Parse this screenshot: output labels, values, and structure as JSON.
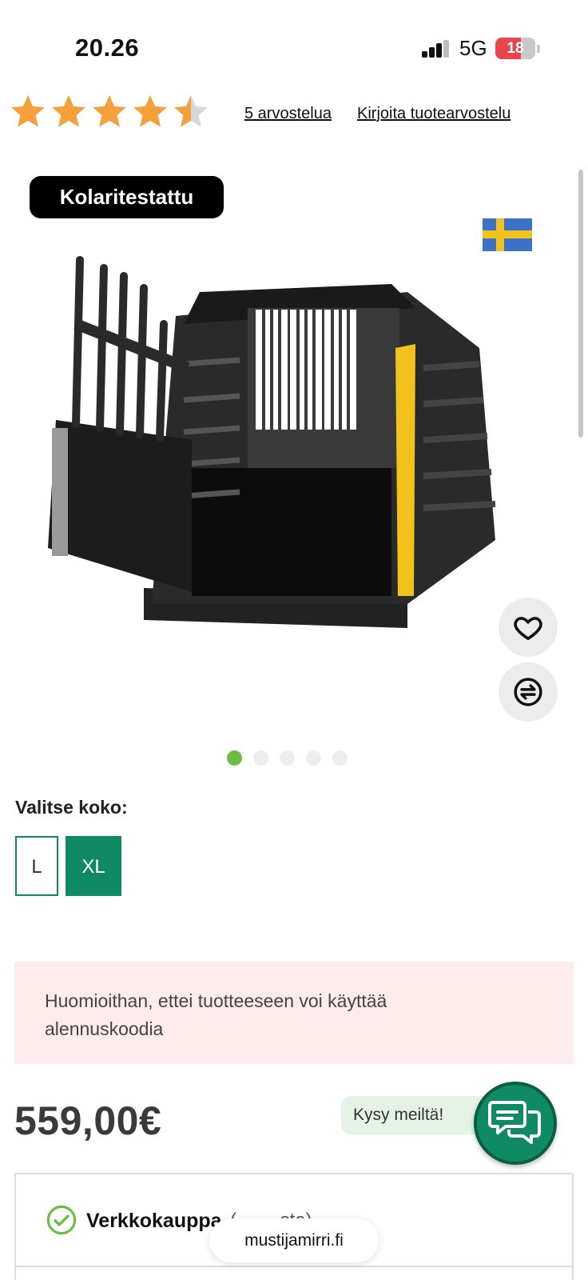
{
  "status_bar": {
    "time": "20.26",
    "network": "5G",
    "battery": "18"
  },
  "rating": {
    "value": 4.5,
    "max": 5,
    "star_color": "#f5a03a",
    "reviews_link": "5 arvostelua",
    "write_review_link": "Kirjoita tuotearvostelu"
  },
  "product": {
    "badge": "Kolaritestattu",
    "flag": "sweden-flag",
    "image": "dog-crate-image",
    "gallery_count": 5,
    "gallery_active": 1
  },
  "size": {
    "label": "Valitse koko:",
    "options": [
      "L",
      "XL"
    ],
    "selected": "XL"
  },
  "notice": {
    "text": "Huomioithan, ettei tuotteeseen voi käyttää alennuskoodia"
  },
  "price": "559,00€",
  "chat": {
    "label": "Kysy meiltä!"
  },
  "stock": {
    "label": "Verkkokauppa",
    "detail": "(… …sta)"
  },
  "browser": {
    "url": "mustijamirri.fi"
  },
  "colors": {
    "brand_green": "#0f8a63",
    "dot_active": "#6bbd45",
    "notice_bg": "#fdeceb"
  }
}
